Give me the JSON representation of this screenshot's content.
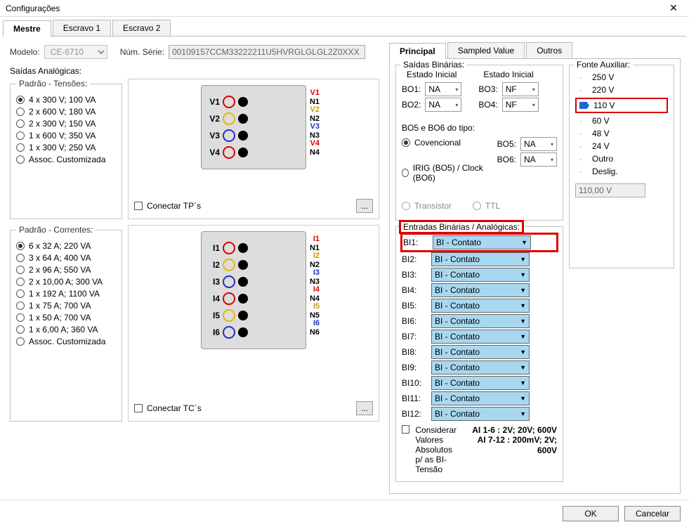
{
  "window": {
    "title": "Configurações"
  },
  "tabs_left": {
    "mestre": "Mestre",
    "escravo1": "Escravo 1",
    "escravo2": "Escravo 2"
  },
  "modelo": {
    "label": "Modelo:",
    "value": "CE-6710",
    "serie_label": "Núm. Série:",
    "serie_value": "00109157CCM33222211U5HVRGLGLGL2Z0XXX"
  },
  "saidas_analogicas": {
    "title": "Saídas Analógicas:",
    "tensoes": {
      "title": "Padrão - Tensões:",
      "opts": [
        "4 x 300 V; 100 VA",
        "2 x 600 V; 180 VA",
        "2 x 300 V; 150 VA",
        "1 x 600 V; 350 VA",
        "1 x 300 V; 250 VA",
        "Assoc. Customizada"
      ],
      "selected": 0,
      "conectar": "Conectar TP´s",
      "ch_prefix": "V",
      "aux_prefix": "N"
    },
    "correntes": {
      "title": "Padrão - Correntes:",
      "opts": [
        "6 x 32 A; 220 VA",
        "3 x 64 A; 400 VA",
        "2 x 96 A; 550 VA",
        "2 x 10,00 A; 300 VA",
        "1 x 192 A; 1100 VA",
        "1 x 75 A; 700 VA",
        "1 x 50 A; 700 VA",
        "1 x 6,00 A; 360 VA",
        "Assoc. Customizada"
      ],
      "selected": 0,
      "conectar": "Conectar TC´s",
      "ch_prefix": "I",
      "aux_prefix": "N"
    }
  },
  "tabs_right": {
    "principal": "Principal",
    "sampled": "Sampled Value",
    "outros": "Outros"
  },
  "saidas_bin": {
    "title": "Saídas Binárias:",
    "estado_inicial": "Estado Inicial",
    "bo": [
      {
        "label": "BO1:",
        "val": "NA"
      },
      {
        "label": "BO2:",
        "val": "NA"
      },
      {
        "label": "BO3:",
        "val": "NF"
      },
      {
        "label": "BO4:",
        "val": "NF"
      }
    ],
    "bo56_title": "BO5 e BO6 do tipo:",
    "convencial": "Covencional",
    "irig": "IRIG (BO5) / Clock (BO6)",
    "bo5": {
      "label": "BO5:",
      "val": "NA"
    },
    "bo6": {
      "label": "BO6:",
      "val": "NA"
    },
    "transistor": "Transistor",
    "ttl": "TTL"
  },
  "fonte_aux": {
    "title": "Fonte Auxiliar:",
    "opts": [
      "250 V",
      "220 V",
      "110 V",
      "60 V",
      "48 V",
      "24 V",
      "Outro",
      "Deslig."
    ],
    "selected": 2,
    "value": "110,00 V"
  },
  "entradas_bin": {
    "title": "Entradas Binárias / Analógicas:",
    "items": [
      {
        "label": "BI1:",
        "val": "BI - Contato"
      },
      {
        "label": "BI2:",
        "val": "BI - Contato"
      },
      {
        "label": "BI3:",
        "val": "BI - Contato"
      },
      {
        "label": "BI4:",
        "val": "BI - Contato"
      },
      {
        "label": "BI5:",
        "val": "BI - Contato"
      },
      {
        "label": "BI6:",
        "val": "BI - Contato"
      },
      {
        "label": "BI7:",
        "val": "BI - Contato"
      },
      {
        "label": "BI8:",
        "val": "BI - Contato"
      },
      {
        "label": "BI9:",
        "val": "BI - Contato"
      },
      {
        "label": "BI10:",
        "val": "BI - Contato"
      },
      {
        "label": "BI11:",
        "val": "BI - Contato"
      },
      {
        "label": "BI12:",
        "val": "BI - Contato"
      }
    ],
    "considerar": "Considerar Valores Absolutos p/ as BI-Tensão",
    "note1": "AI 1-6 : 2V; 20V; 600V",
    "note2": "AI 7-12 : 200mV; 2V; 600V"
  },
  "footer": {
    "ok": "OK",
    "cancel": "Cancelar"
  }
}
